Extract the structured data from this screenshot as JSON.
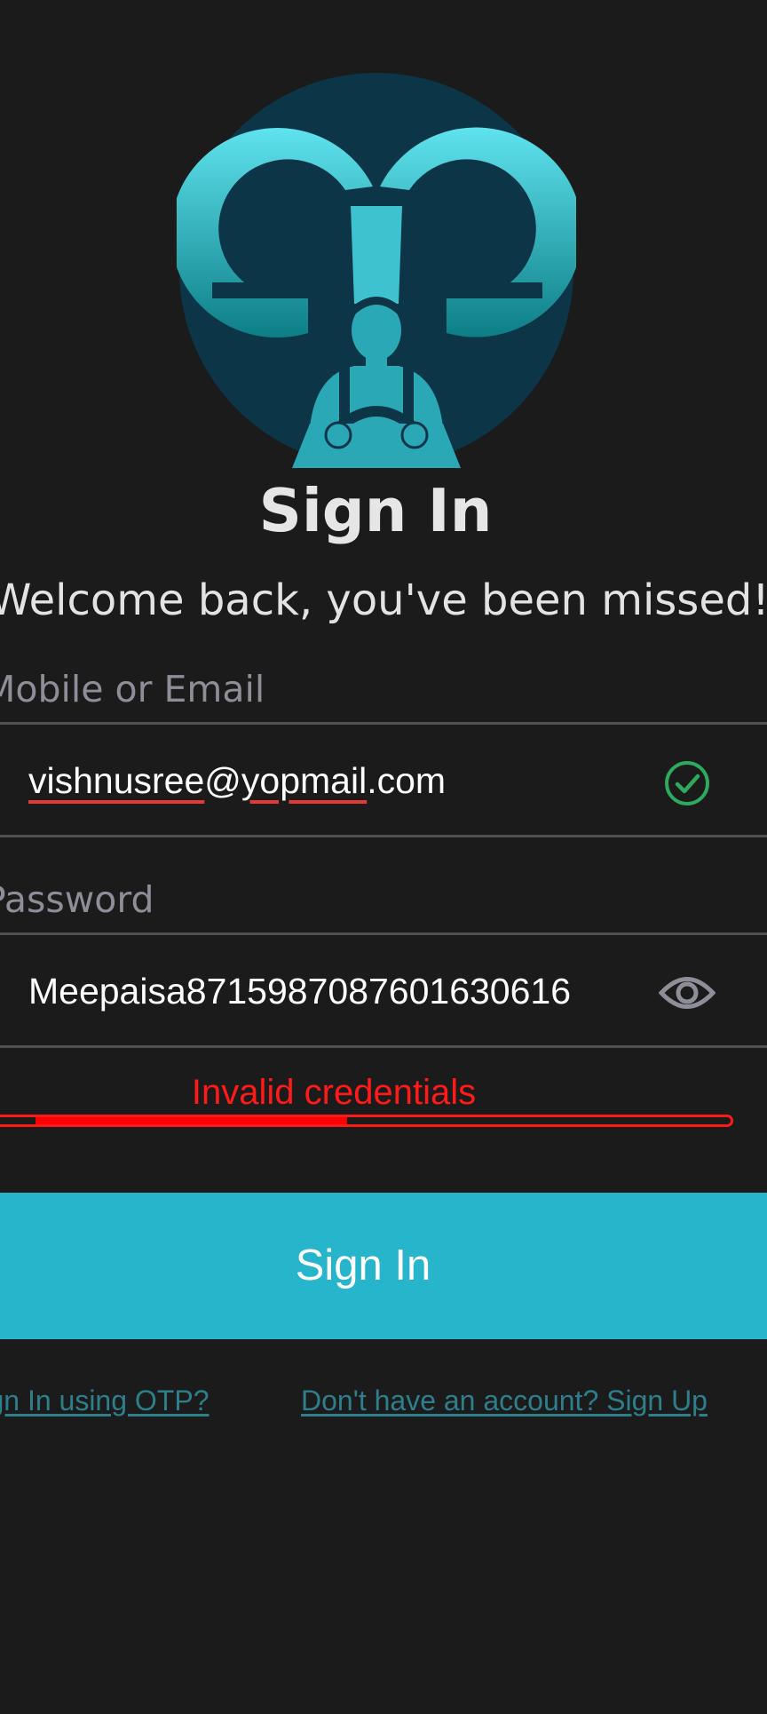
{
  "header": {
    "title": "Sign In",
    "subtitle": "Welcome back, you've been missed!"
  },
  "form": {
    "email_label": "Mobile or Email",
    "email_value_parts": [
      "vishnusree",
      "@",
      "yopmail",
      ".com"
    ],
    "password_label": "Password",
    "password_value": "Meepaisa871598708760163061​6",
    "error_message": "Invalid credentials",
    "error_bar_fill_start": 0.068,
    "error_bar_fill_end": 0.486
  },
  "actions": {
    "signin_label": "Sign In",
    "otp_link": "Sign In using OTP?",
    "signup_link": "Don't have an account? Sign Up"
  },
  "icons": {
    "valid_icon": "check-circle-icon",
    "toggle_visibility_icon": "eye-icon"
  },
  "colors": {
    "background": "#1b1b1b",
    "accent": "#26b5cb",
    "error": "#ff1a1a",
    "success": "#2eaa5f",
    "link": "#2d7f8c"
  }
}
